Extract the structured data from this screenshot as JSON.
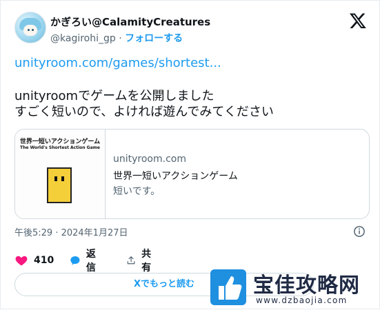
{
  "author": {
    "display_name": "かぎろい@CalamityCreatures",
    "handle": "@kagirohi_gp",
    "separator": "·",
    "follow_label": "フォローする"
  },
  "tweet": {
    "link_text": "unityroom.com/games/shortest...",
    "line1": "unityroomでゲームを公開しました",
    "line2": "すごく短いので、よければ遊んでみてください"
  },
  "link_card": {
    "thumb_title": "世界一短いアクションゲーム",
    "thumb_subtitle": "The World's Shortest Action Game",
    "domain": "unityroom.com",
    "title": "世界一短いアクションゲーム",
    "description": "短いです。"
  },
  "timestamp": "午後5:29 · 2024年1月27日",
  "actions": {
    "likes_count": "410",
    "reply_label": "返信",
    "share_label": "共有"
  },
  "read_more_label": "Xでもっと読む",
  "watermark": {
    "name": "宝佳攻略网",
    "url": "www.dzbaojia.com"
  },
  "colors": {
    "accent": "#1d9bf0",
    "like": "#f91880",
    "text": "#0f1419",
    "muted": "#536471"
  },
  "icons": [
    "x-logo-icon",
    "info-icon",
    "heart-icon",
    "reply-bubble-icon",
    "share-icon"
  ]
}
